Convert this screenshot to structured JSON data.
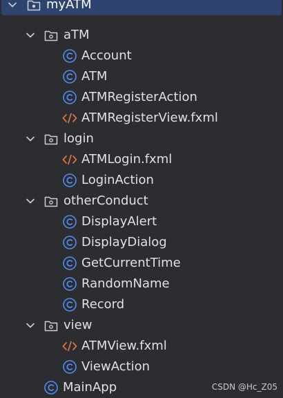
{
  "colors": {
    "background": "#2b2d30",
    "selection": "#2e436e",
    "text": "#dfe1e5",
    "class_icon": "#548af7",
    "fxml_icon": "#e0754a",
    "folder_icon": "#ced0d6"
  },
  "tree": {
    "root": {
      "label": "myATM",
      "icon": "folder-icon",
      "expanded": true,
      "selected": true
    },
    "packages": [
      {
        "label": "aTM",
        "icon": "package-folder-icon",
        "expanded": true,
        "children": [
          {
            "label": "Account",
            "icon": "java-class-icon"
          },
          {
            "label": "ATM",
            "icon": "java-class-icon"
          },
          {
            "label": "ATMRegisterAction",
            "icon": "java-class-icon"
          },
          {
            "label": "ATMRegisterView.fxml",
            "icon": "fxml-file-icon"
          }
        ]
      },
      {
        "label": "login",
        "icon": "package-folder-icon",
        "expanded": true,
        "children": [
          {
            "label": "ATMLogin.fxml",
            "icon": "fxml-file-icon"
          },
          {
            "label": "LoginAction",
            "icon": "java-class-icon"
          }
        ]
      },
      {
        "label": "otherConduct",
        "icon": "package-folder-icon",
        "expanded": true,
        "children": [
          {
            "label": "DisplayAlert",
            "icon": "java-class-icon"
          },
          {
            "label": "DisplayDialog",
            "icon": "java-class-icon"
          },
          {
            "label": "GetCurrentTime",
            "icon": "java-class-icon"
          },
          {
            "label": "RandomName",
            "icon": "java-class-icon"
          },
          {
            "label": "Record",
            "icon": "java-class-icon"
          }
        ]
      },
      {
        "label": "view",
        "icon": "package-folder-icon",
        "expanded": true,
        "children": [
          {
            "label": "ATMView.fxml",
            "icon": "fxml-file-icon"
          },
          {
            "label": "ViewAction",
            "icon": "java-class-icon"
          }
        ]
      }
    ],
    "main_class": {
      "label": "MainApp",
      "icon": "java-class-icon"
    }
  },
  "watermark": "CSDN @Hc_Z05"
}
